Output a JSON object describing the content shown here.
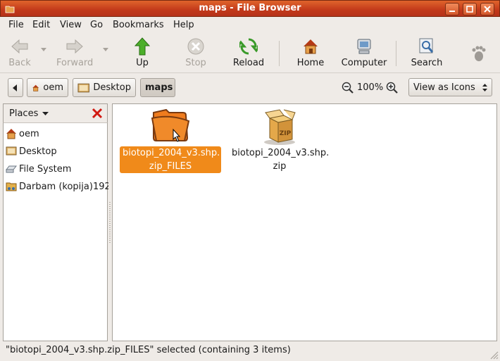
{
  "window": {
    "title": "maps - File Browser",
    "accent": "#c2391a"
  },
  "menu": {
    "file": "File",
    "edit": "Edit",
    "view": "View",
    "go": "Go",
    "bookmarks": "Bookmarks",
    "help": "Help"
  },
  "toolbar": {
    "back": "Back",
    "forward": "Forward",
    "up": "Up",
    "stop": "Stop",
    "reload": "Reload",
    "home": "Home",
    "computer": "Computer",
    "search": "Search"
  },
  "location": {
    "path": [
      "oem",
      "Desktop",
      "maps"
    ],
    "zoom": "100%",
    "view_mode": "View as Icons"
  },
  "sidebar": {
    "header": "Places",
    "items": [
      {
        "label": "oem",
        "icon": "home-folder-icon"
      },
      {
        "label": "Desktop",
        "icon": "desktop-icon"
      },
      {
        "label": "File System",
        "icon": "drive-icon"
      },
      {
        "label": "Darbam (kopija)192",
        "icon": "network-folder-icon"
      }
    ]
  },
  "files": [
    {
      "line1": "biotopi_2004_v3.shp.",
      "line2": "zip_FILES",
      "icon": "folder-icon",
      "selected": true
    },
    {
      "line1": "biotopi_2004_v3.shp.",
      "line2": "zip",
      "icon": "zip-archive-icon",
      "selected": false
    }
  ],
  "status": {
    "text": "\"biotopi_2004_v3.shp.zip_FILES\" selected (containing 3 items)"
  },
  "colors": {
    "selection": "#f08a1a",
    "titlebar": "#c2391a"
  }
}
